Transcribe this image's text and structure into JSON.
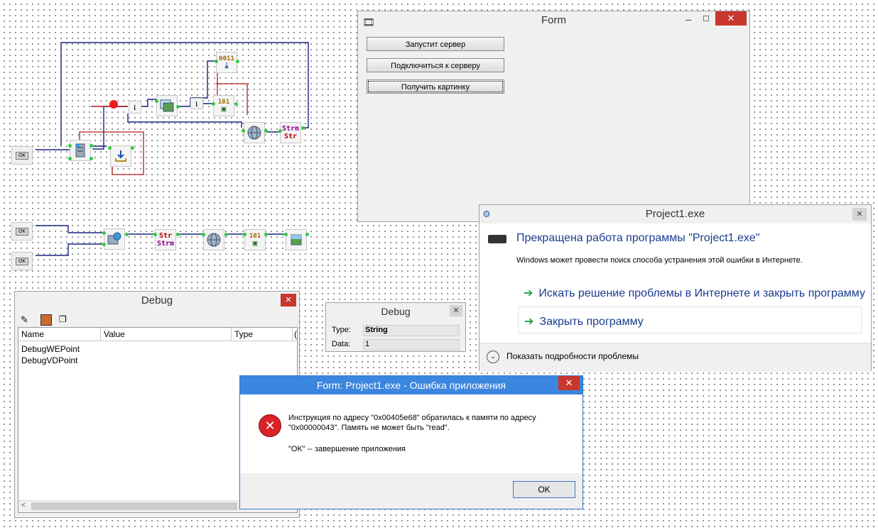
{
  "form": {
    "title": "Form",
    "buttons": [
      "Запустит сервер",
      "Подключиться к серверу",
      "Получить картинку"
    ],
    "min_symbol": "–",
    "max_symbol": "☐",
    "close_symbol": "✕"
  },
  "crash_dialog": {
    "title": "Project1.exe",
    "heading": "Прекращена работа программы \"Project1.exe\"",
    "message": "Windows может провести поиск способа устранения этой ошибки в Интернете.",
    "option_search": "Искать решение проблемы в Интернете и закрыть программу",
    "option_close": "Закрыть программу",
    "details": "Показать подробности проблемы",
    "close_symbol": "✕"
  },
  "debug_window": {
    "title": "Debug",
    "columns": [
      "Name",
      "Value",
      "Type",
      "("
    ],
    "rows": [
      "DebugWEPoint",
      "DebugVDPoint"
    ],
    "close_symbol": "✕",
    "scroll_left": "<"
  },
  "debug_small": {
    "title": "Debug",
    "type_label": "Type:",
    "type_value": "String",
    "data_label": "Data:",
    "data_value": "1",
    "close_symbol": "✕"
  },
  "app_error": {
    "title": "Form: Project1.exe - Ошибка приложения",
    "line1": "Инструкция по адресу \"0x00405e68\" обратилась к памяти по адресу",
    "line2": "\"0x00000043\". Память не может быть \"read\".",
    "line3": "\"OK\" -- завершение приложения",
    "ok_label": "OK",
    "close_symbol": "✕"
  },
  "schematic": {
    "ok_label": "OK",
    "binary_label": "0011",
    "bin2_label": "101",
    "strm_top": "Strm",
    "strm_bottom": "Str",
    "str_top": "Str",
    "str_bottom": "Strm"
  },
  "colors": {
    "wire_blue": "#1a237e",
    "wire_red": "#b71c1c",
    "close_red": "#c8372d",
    "link_blue": "#1a3c8f"
  }
}
